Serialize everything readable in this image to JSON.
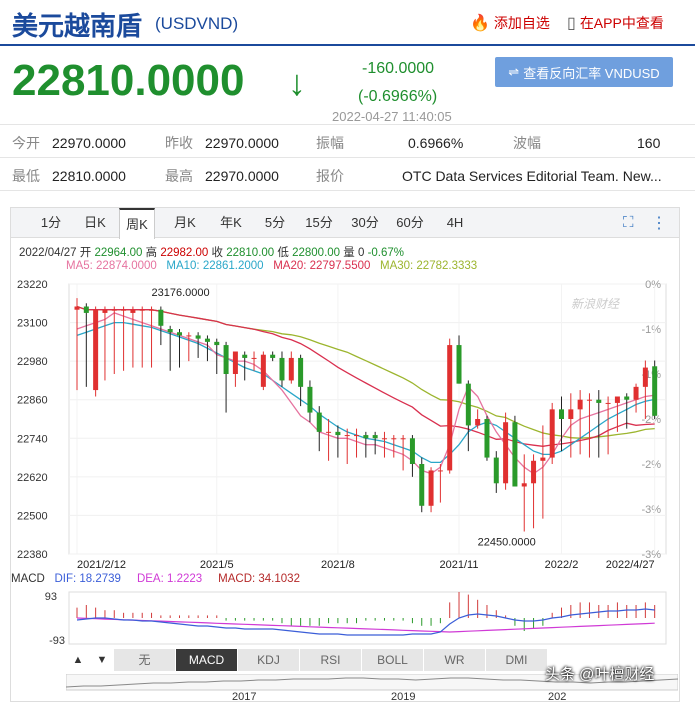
{
  "header": {
    "title": "美元越南盾",
    "code": "(USDVND)",
    "add_favorite": "添加自选",
    "view_in_app": "在APP中查看"
  },
  "quote": {
    "price": "22810.0000",
    "change": "-160.0000",
    "change_pct": "(-0.6966%)",
    "timestamp": "2022-04-27 11:40:05",
    "reverse_button": "查看反向汇率 VNDUSD"
  },
  "stats": [
    {
      "label": "今开",
      "value": "22970.0000"
    },
    {
      "label": "昨收",
      "value": "22970.0000"
    },
    {
      "label": "振幅",
      "value": "0.6966%"
    },
    {
      "label": "波幅",
      "value": "160"
    },
    {
      "label": "最低",
      "value": "22810.0000"
    },
    {
      "label": "最高",
      "value": "22970.0000"
    },
    {
      "label": "报价",
      "value": "OTC Data Services Editorial Team. New..."
    }
  ],
  "tabs": [
    "1分",
    "日K",
    "周K",
    "月K",
    "年K",
    "5分",
    "15分",
    "30分",
    "60分",
    "4H"
  ],
  "active_tab": "周K",
  "bar_info": {
    "date": "2022/04/27",
    "open_label": "开",
    "open": "22964.00",
    "high_label": "高",
    "high": "22982.00",
    "close_label": "收",
    "close": "22810.00",
    "low_label": "低",
    "low": "22800.00",
    "vol_label": "量",
    "vol": "0",
    "pct": "-0.67%"
  },
  "ma": {
    "ma5": "MA5: 22874.0000",
    "ma10": "MA10: 22861.2000",
    "ma20": "MA20: 22797.5500",
    "ma30": "MA30: 22782.3333"
  },
  "chart_data": {
    "type": "candlestick",
    "y_ticks": [
      "23220",
      "23100",
      "22980",
      "22860",
      "22740",
      "22620",
      "22500",
      "22380"
    ],
    "pct_ticks": [
      "0%",
      "-1%",
      "-1%",
      "-2%",
      "-2%",
      "-3%",
      "-3%"
    ],
    "x_ticks": [
      "2021/2/12",
      "2021/5",
      "2021/8",
      "2021/11",
      "2022/2",
      "2022/4/27"
    ],
    "ylim": [
      22380,
      23220
    ],
    "max_label": "23176.0000",
    "min_label": "22450.0000",
    "watermark": "新浪财经",
    "colors": {
      "up": "#e03030",
      "down": "#2a9a2a",
      "ma5": "#e6739f",
      "ma10": "#2aa7c9",
      "ma20": "#d9304f",
      "ma30": "#9cb52e"
    },
    "ohlc": [
      [
        23140,
        23176,
        22890,
        23150
      ],
      [
        23150,
        23160,
        22900,
        23130
      ],
      [
        22890,
        23150,
        22870,
        23140
      ],
      [
        23130,
        23150,
        22920,
        23140
      ],
      [
        23140,
        23150,
        22940,
        23140
      ],
      [
        23140,
        23150,
        22950,
        23140
      ],
      [
        23130,
        23150,
        22960,
        23140
      ],
      [
        23140,
        23150,
        22960,
        23140
      ],
      [
        23140,
        23150,
        22960,
        23140
      ],
      [
        23140,
        23150,
        23030,
        23090
      ],
      [
        23080,
        23090,
        22950,
        23070
      ],
      [
        23070,
        23080,
        22960,
        23060
      ],
      [
        23060,
        23070,
        22980,
        23060
      ],
      [
        23060,
        23070,
        22990,
        23050
      ],
      [
        23050,
        23060,
        22980,
        23040
      ],
      [
        23040,
        23050,
        22940,
        23030
      ],
      [
        23030,
        23040,
        22820,
        22940
      ],
      [
        22940,
        23010,
        22900,
        23010
      ],
      [
        23000,
        23010,
        22920,
        22990
      ],
      [
        22990,
        23010,
        22950,
        22990
      ],
      [
        22900,
        23010,
        22890,
        23000
      ],
      [
        23000,
        23010,
        22980,
        22990
      ],
      [
        22990,
        23010,
        22900,
        22920
      ],
      [
        22920,
        23010,
        22910,
        22990
      ],
      [
        22990,
        23000,
        22840,
        22900
      ],
      [
        22900,
        22920,
        22790,
        22820
      ],
      [
        22820,
        22840,
        22700,
        22760
      ],
      [
        22760,
        22800,
        22670,
        22760
      ],
      [
        22760,
        22780,
        22680,
        22750
      ],
      [
        22750,
        22770,
        22660,
        22750
      ],
      [
        22750,
        22770,
        22680,
        22750
      ],
      [
        22750,
        22760,
        22680,
        22740
      ],
      [
        22750,
        22760,
        22690,
        22740
      ],
      [
        22740,
        22760,
        22680,
        22740
      ],
      [
        22740,
        22750,
        22680,
        22740
      ],
      [
        22740,
        22750,
        22640,
        22740
      ],
      [
        22740,
        22750,
        22620,
        22660
      ],
      [
        22660,
        22680,
        22510,
        22530
      ],
      [
        22530,
        22650,
        22510,
        22640
      ],
      [
        22640,
        22660,
        22540,
        22640
      ],
      [
        22640,
        23050,
        22630,
        23030
      ],
      [
        23030,
        23060,
        22910,
        22910
      ],
      [
        22910,
        22920,
        22700,
        22780
      ],
      [
        22780,
        22830,
        22770,
        22800
      ],
      [
        22800,
        22810,
        22670,
        22680
      ],
      [
        22680,
        22700,
        22570,
        22600
      ],
      [
        22600,
        22820,
        22580,
        22790
      ],
      [
        22790,
        22810,
        22590,
        22590
      ],
      [
        22590,
        22690,
        22450,
        22600
      ],
      [
        22600,
        22690,
        22460,
        22670
      ],
      [
        22670,
        22780,
        22490,
        22680
      ],
      [
        22680,
        22850,
        22660,
        22830
      ],
      [
        22830,
        22870,
        22700,
        22800
      ],
      [
        22800,
        22880,
        22680,
        22830
      ],
      [
        22830,
        22890,
        22690,
        22860
      ],
      [
        22860,
        22880,
        22680,
        22860
      ],
      [
        22860,
        22890,
        22680,
        22850
      ],
      [
        22850,
        22870,
        22690,
        22850
      ],
      [
        22850,
        22870,
        22760,
        22870
      ],
      [
        22870,
        22880,
        22770,
        22860
      ],
      [
        22860,
        22910,
        22820,
        22900
      ],
      [
        22900,
        22982,
        22800,
        22960
      ],
      [
        22964,
        22982,
        22800,
        22810
      ]
    ],
    "ma_series": {
      "ma5": [
        23080,
        23090,
        23100,
        23110,
        23130,
        23120,
        23110,
        23100,
        23090,
        23080,
        23070,
        23060,
        23050,
        23040,
        23030,
        23000,
        22990,
        22980,
        22980,
        22970,
        22950,
        22920,
        22890,
        22850,
        22810,
        22790,
        22760,
        22750,
        22740,
        22740,
        22730,
        22720,
        22720,
        22710,
        22700,
        22690,
        22670,
        22640,
        22630,
        22650,
        22720,
        22830,
        22900,
        22870,
        22810,
        22760,
        22720,
        22680,
        22650,
        22630,
        22650,
        22690,
        22740,
        22780,
        22800,
        22810,
        22820,
        22830,
        22840,
        22850,
        22860,
        22870,
        22874
      ],
      "ma10": [
        23060,
        23070,
        23080,
        23090,
        23100,
        23100,
        23095,
        23090,
        23085,
        23075,
        23065,
        23055,
        23045,
        23035,
        23020,
        23005,
        22990,
        22975,
        22960,
        22950,
        22940,
        22920,
        22900,
        22880,
        22860,
        22840,
        22815,
        22795,
        22775,
        22760,
        22750,
        22740,
        22735,
        22730,
        22720,
        22710,
        22700,
        22680,
        22665,
        22665,
        22690,
        22720,
        22760,
        22780,
        22790,
        22780,
        22760,
        22740,
        22720,
        22700,
        22690,
        22690,
        22700,
        22720,
        22740,
        22760,
        22780,
        22800,
        22815,
        22830,
        22845,
        22855,
        22861
      ]
    },
    "macd": {
      "dif": "DIF: 18.2739",
      "dea": "DEA: 1.2223",
      "macd": "MACD: 34.1032",
      "y_ticks": [
        "93",
        "-93"
      ]
    },
    "overview_ticks": [
      "2017",
      "2019",
      "202"
    ]
  },
  "indicators": [
    "无",
    "MACD",
    "KDJ",
    "RSI",
    "BOLL",
    "WR",
    "DMI"
  ],
  "active_indicator": "MACD",
  "watermark_text": "头条 @叶檀财经"
}
